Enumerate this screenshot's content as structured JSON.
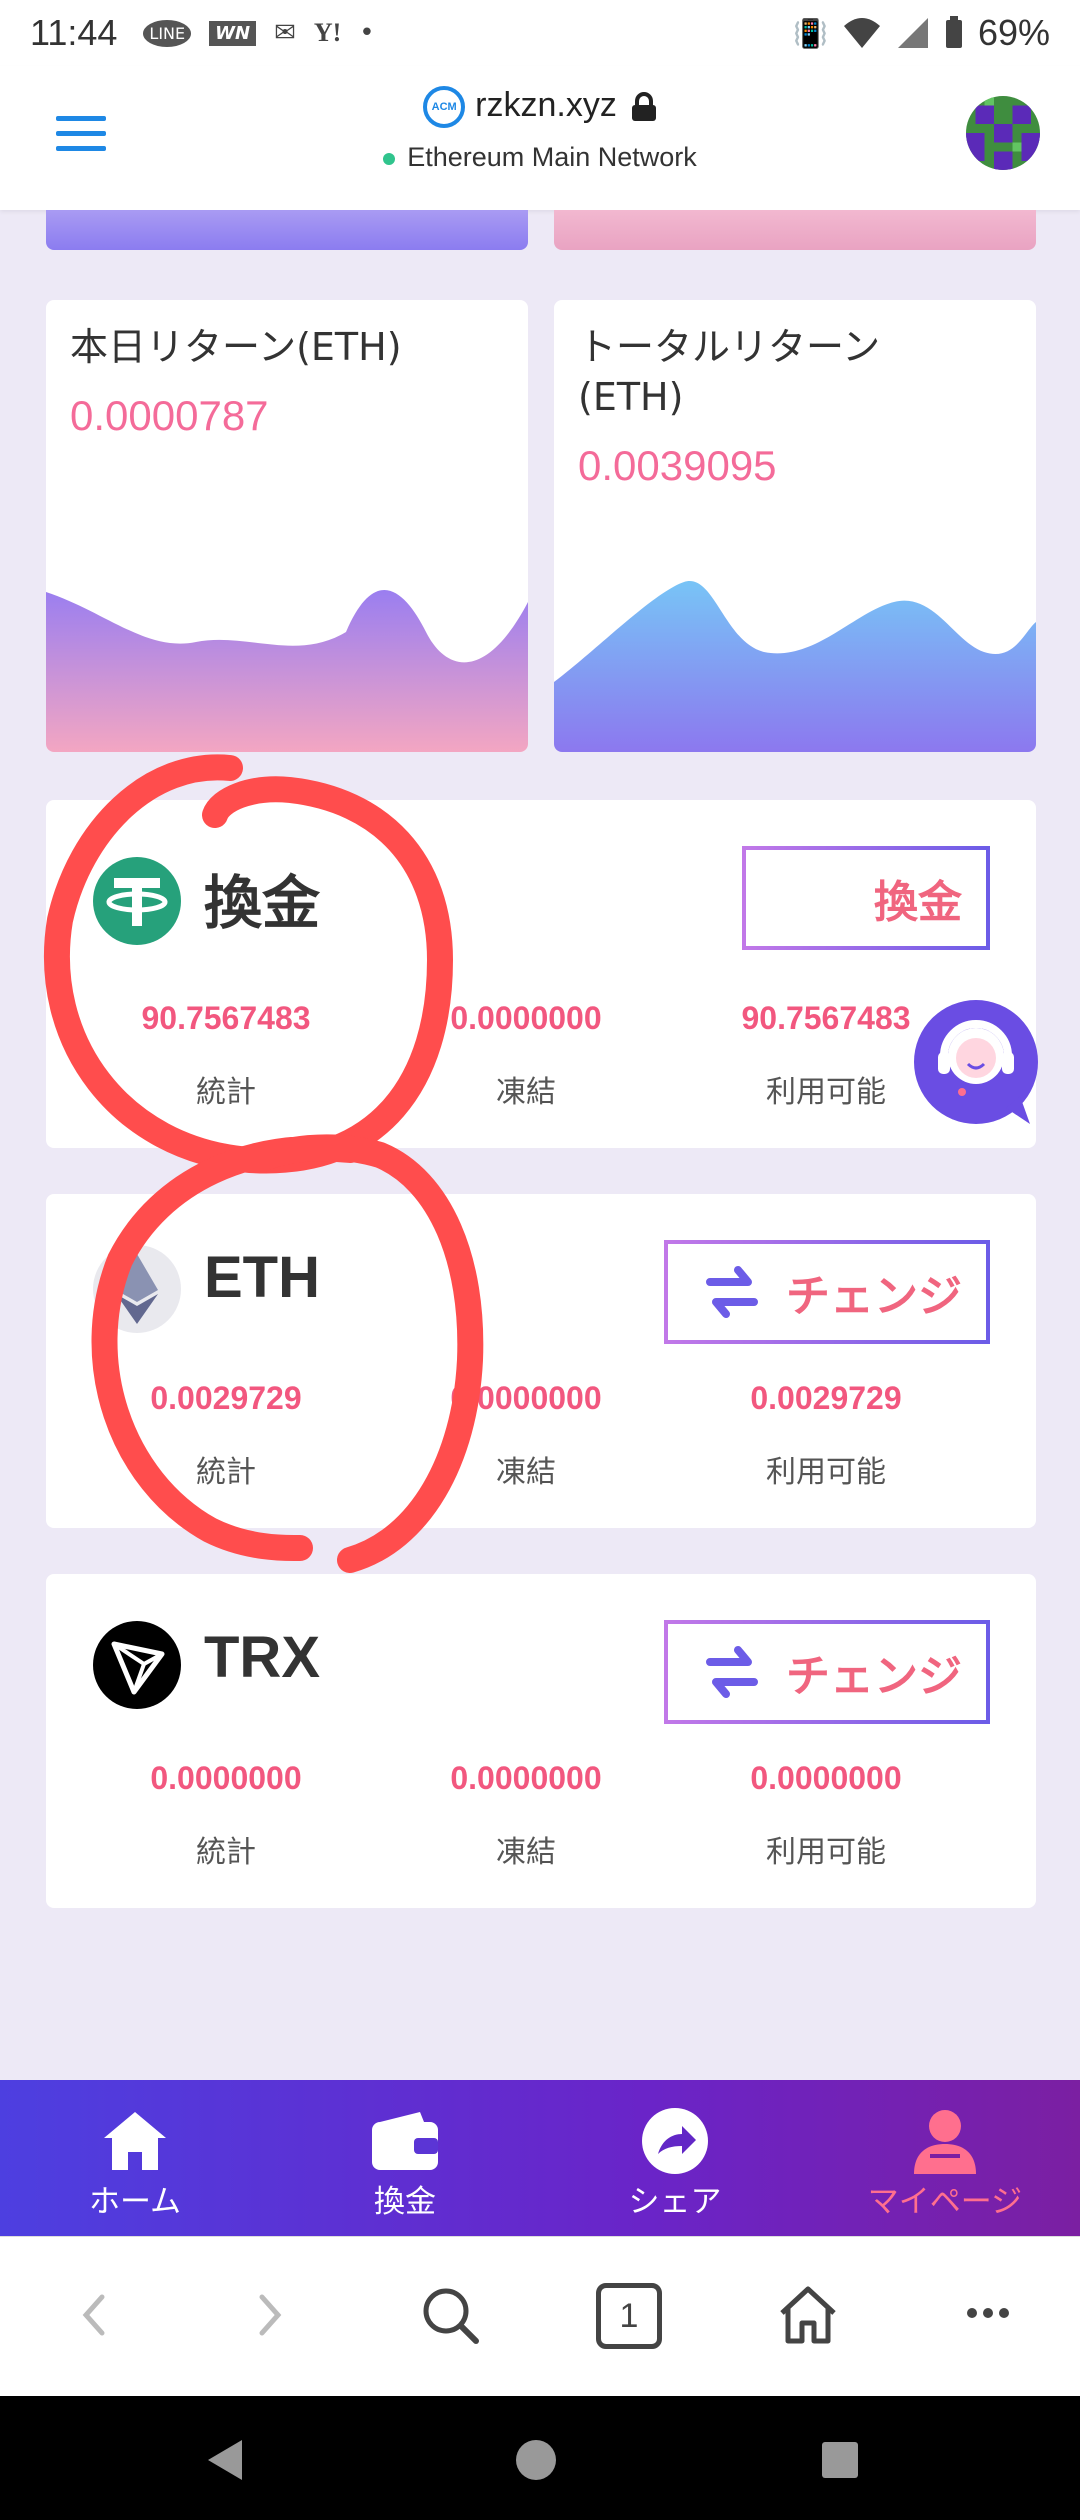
{
  "status_bar": {
    "time": "11:44",
    "notif_icons": [
      "line-icon",
      "wn-icon",
      "mail-icon",
      "yahoo-icon"
    ],
    "notif_labels": [
      "LINE",
      "WN",
      "Y!"
    ],
    "battery": "69%"
  },
  "header": {
    "site_logo_text": "ACM",
    "site": "rzkzn.xyz",
    "network": "Ethereum Main Network"
  },
  "returns": {
    "today": {
      "title": "本日リターン(ETH)",
      "value": "0.0000787"
    },
    "total": {
      "title": "トータルリターン(ETH)",
      "value": "0.0039095"
    }
  },
  "assets": [
    {
      "name": "換金",
      "button": "換金",
      "stats": [
        "90.7567483",
        "0.0000000",
        "90.7567483"
      ],
      "labels": [
        "統計",
        "凍結",
        "利用可能"
      ]
    },
    {
      "name": "ETH",
      "button": "チェンジ",
      "stats": [
        "0.0029729",
        "0.0000000",
        "0.0029729"
      ],
      "labels": [
        "統計",
        "凍結",
        "利用可能"
      ]
    },
    {
      "name": "TRX",
      "button": "チェンジ",
      "stats": [
        "0.0000000",
        "0.0000000",
        "0.0000000"
      ],
      "labels": [
        "統計",
        "凍結",
        "利用可能"
      ]
    }
  ],
  "bottom_nav": [
    {
      "label": "ホーム",
      "icon": "home-icon"
    },
    {
      "label": "換金",
      "icon": "wallet-icon"
    },
    {
      "label": "シェア",
      "icon": "share-icon"
    },
    {
      "label": "マイページ",
      "icon": "user-icon",
      "active": true
    }
  ],
  "browser": {
    "tab_count": "1"
  },
  "colors": {
    "accent_pink": "#f2577f",
    "nav_gradient_start": "#4d3fe0",
    "nav_gradient_end": "#7b1fa2",
    "annotation_red": "#ff4d4d"
  }
}
